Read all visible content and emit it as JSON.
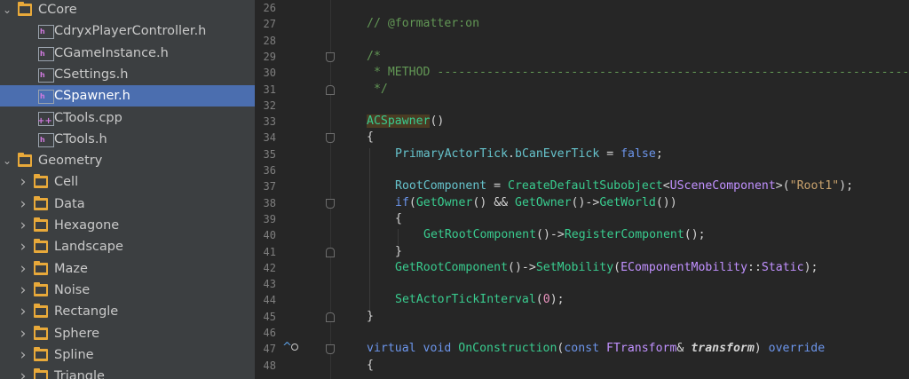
{
  "tree": [
    {
      "type": "folder",
      "label": "CCore",
      "depth": 0,
      "expanded": true
    },
    {
      "type": "file",
      "label": "CdryxPlayerController.h",
      "depth": 1,
      "kind": "header"
    },
    {
      "type": "file",
      "label": "CGameInstance.h",
      "depth": 1,
      "kind": "header"
    },
    {
      "type": "file",
      "label": "CSettings.h",
      "depth": 1,
      "kind": "header"
    },
    {
      "type": "file",
      "label": "CSpawner.h",
      "depth": 1,
      "kind": "header",
      "selected": true
    },
    {
      "type": "file",
      "label": "CTools.cpp",
      "depth": 1,
      "kind": "source"
    },
    {
      "type": "file",
      "label": "CTools.h",
      "depth": 1,
      "kind": "header"
    },
    {
      "type": "folder",
      "label": "Geometry",
      "depth": 0,
      "expanded": true
    },
    {
      "type": "folder",
      "label": "Cell",
      "depth": 1,
      "expanded": false
    },
    {
      "type": "folder",
      "label": "Data",
      "depth": 1,
      "expanded": false
    },
    {
      "type": "folder",
      "label": "Hexagone",
      "depth": 1,
      "expanded": false
    },
    {
      "type": "folder",
      "label": "Landscape",
      "depth": 1,
      "expanded": false
    },
    {
      "type": "folder",
      "label": "Maze",
      "depth": 1,
      "expanded": false
    },
    {
      "type": "folder",
      "label": "Noise",
      "depth": 1,
      "expanded": false
    },
    {
      "type": "folder",
      "label": "Rectangle",
      "depth": 1,
      "expanded": false
    },
    {
      "type": "folder",
      "label": "Sphere",
      "depth": 1,
      "expanded": false
    },
    {
      "type": "folder",
      "label": "Spline",
      "depth": 1,
      "expanded": false
    },
    {
      "type": "folder",
      "label": "Triangle",
      "depth": 1,
      "expanded": false
    }
  ],
  "colors": {
    "comment": "#629755",
    "keyword": "#6c95eb",
    "type": "#c191ff",
    "func": "#39cc8f",
    "string": "#c9a26d",
    "number": "#ed94c0",
    "field": "#66c3cc",
    "plain": "#d4d4d4",
    "highlight": "#4a3b23"
  },
  "lines": [
    {
      "num": "26",
      "indent": 0,
      "tokens": []
    },
    {
      "num": "27",
      "indent": 0,
      "tokens": [
        {
          "t": "// @formatter:on",
          "c": "comment"
        }
      ]
    },
    {
      "num": "28",
      "indent": 0,
      "tokens": []
    },
    {
      "num": "29",
      "indent": 0,
      "fold": "top",
      "tokens": [
        {
          "t": "/*",
          "c": "comment"
        }
      ]
    },
    {
      "num": "30",
      "indent": 0,
      "tokens": [
        {
          "t": " * METHOD -------------------------------------------------------------------",
          "c": "comment"
        }
      ]
    },
    {
      "num": "31",
      "indent": 0,
      "fold": "bottom",
      "tokens": [
        {
          "t": " */",
          "c": "comment"
        }
      ]
    },
    {
      "num": "32",
      "indent": 0,
      "tokens": []
    },
    {
      "num": "33",
      "indent": 0,
      "tokens": [
        {
          "t": "ACSpawner",
          "c": "func",
          "hl": true
        },
        {
          "t": "()",
          "c": "plain"
        }
      ]
    },
    {
      "num": "34",
      "indent": 0,
      "fold": "top",
      "tokens": [
        {
          "t": "{",
          "c": "plain"
        }
      ]
    },
    {
      "num": "35",
      "indent": 1,
      "tokens": [
        {
          "t": "PrimaryActorTick",
          "c": "field"
        },
        {
          "t": ".",
          "c": "plain"
        },
        {
          "t": "bCanEverTick",
          "c": "field"
        },
        {
          "t": " = ",
          "c": "plain"
        },
        {
          "t": "false",
          "c": "keyword"
        },
        {
          "t": ";",
          "c": "plain"
        }
      ]
    },
    {
      "num": "36",
      "indent": 0,
      "tokens": []
    },
    {
      "num": "37",
      "indent": 1,
      "tokens": [
        {
          "t": "RootComponent",
          "c": "field"
        },
        {
          "t": " = ",
          "c": "plain"
        },
        {
          "t": "CreateDefaultSubobject",
          "c": "func"
        },
        {
          "t": "<",
          "c": "plain"
        },
        {
          "t": "USceneComponent",
          "c": "type"
        },
        {
          "t": ">(",
          "c": "plain"
        },
        {
          "t": "\"Root1\"",
          "c": "string"
        },
        {
          "t": ");",
          "c": "plain"
        }
      ]
    },
    {
      "num": "38",
      "indent": 1,
      "fold": "top",
      "tokens": [
        {
          "t": "if",
          "c": "keyword"
        },
        {
          "t": "(",
          "c": "plain"
        },
        {
          "t": "GetOwner",
          "c": "func"
        },
        {
          "t": "() && ",
          "c": "plain"
        },
        {
          "t": "GetOwner",
          "c": "func"
        },
        {
          "t": "()->",
          "c": "plain"
        },
        {
          "t": "GetWorld",
          "c": "func"
        },
        {
          "t": "())",
          "c": "plain"
        }
      ]
    },
    {
      "num": "39",
      "indent": 1,
      "tokens": [
        {
          "t": "{",
          "c": "plain"
        }
      ]
    },
    {
      "num": "40",
      "indent": 2,
      "tokens": [
        {
          "t": "GetRootComponent",
          "c": "func"
        },
        {
          "t": "()->",
          "c": "plain"
        },
        {
          "t": "RegisterComponent",
          "c": "func"
        },
        {
          "t": "();",
          "c": "plain"
        }
      ]
    },
    {
      "num": "41",
      "indent": 1,
      "fold": "bottom",
      "tokens": [
        {
          "t": "}",
          "c": "plain"
        }
      ]
    },
    {
      "num": "42",
      "indent": 1,
      "tokens": [
        {
          "t": "GetRootComponent",
          "c": "func"
        },
        {
          "t": "()->",
          "c": "plain"
        },
        {
          "t": "SetMobility",
          "c": "func"
        },
        {
          "t": "(",
          "c": "plain"
        },
        {
          "t": "EComponentMobility",
          "c": "type"
        },
        {
          "t": "::",
          "c": "plain"
        },
        {
          "t": "Static",
          "c": "type"
        },
        {
          "t": ");",
          "c": "plain"
        }
      ]
    },
    {
      "num": "43",
      "indent": 0,
      "tokens": []
    },
    {
      "num": "44",
      "indent": 1,
      "tokens": [
        {
          "t": "SetActorTickInterval",
          "c": "func"
        },
        {
          "t": "(",
          "c": "plain"
        },
        {
          "t": "0",
          "c": "number"
        },
        {
          "t": ");",
          "c": "plain"
        }
      ]
    },
    {
      "num": "45",
      "indent": 0,
      "fold": "bottom",
      "tokens": [
        {
          "t": "}",
          "c": "plain"
        }
      ]
    },
    {
      "num": "46",
      "indent": 0,
      "tokens": []
    },
    {
      "num": "47",
      "indent": 0,
      "fold": "top",
      "marker": true,
      "tokens": [
        {
          "t": "virtual",
          "c": "keyword"
        },
        {
          "t": " ",
          "c": "plain"
        },
        {
          "t": "void",
          "c": "keyword"
        },
        {
          "t": " ",
          "c": "plain"
        },
        {
          "t": "OnConstruction",
          "c": "func"
        },
        {
          "t": "(",
          "c": "plain"
        },
        {
          "t": "const",
          "c": "keyword"
        },
        {
          "t": " ",
          "c": "plain"
        },
        {
          "t": "FTransform",
          "c": "type"
        },
        {
          "t": "& ",
          "c": "plain"
        },
        {
          "t": "transform",
          "c": "param"
        },
        {
          "t": ") ",
          "c": "plain"
        },
        {
          "t": "override",
          "c": "keyword"
        }
      ]
    },
    {
      "num": "48",
      "indent": 0,
      "tokens": [
        {
          "t": "{",
          "c": "plain"
        }
      ]
    }
  ],
  "markers": {
    "override": "^",
    "impl": "o"
  }
}
